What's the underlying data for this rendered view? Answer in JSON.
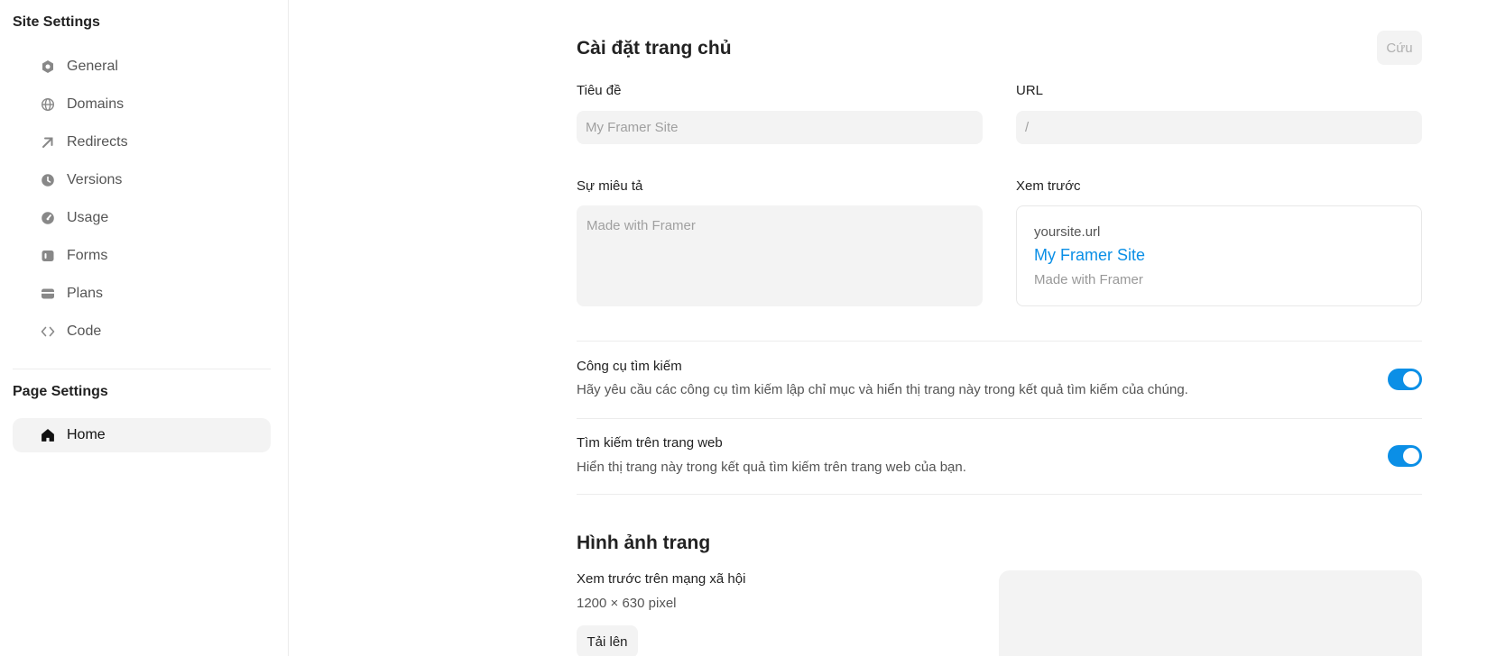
{
  "sidebar": {
    "site_settings_title": "Site Settings",
    "items": [
      {
        "label": "General",
        "icon": "hexagon-icon"
      },
      {
        "label": "Domains",
        "icon": "globe-icon"
      },
      {
        "label": "Redirects",
        "icon": "arrow-up-right-icon"
      },
      {
        "label": "Versions",
        "icon": "clock-icon"
      },
      {
        "label": "Usage",
        "icon": "gauge-icon"
      },
      {
        "label": "Forms",
        "icon": "form-icon"
      },
      {
        "label": "Plans",
        "icon": "card-icon"
      },
      {
        "label": "Code",
        "icon": "code-icon"
      }
    ],
    "page_settings_title": "Page Settings",
    "pages": [
      {
        "label": "Home",
        "icon": "home-icon",
        "active": true
      }
    ]
  },
  "main": {
    "title": "Cài đặt trang chủ",
    "save_label": "Cứu",
    "title_field": {
      "label": "Tiêu đề",
      "value": "",
      "placeholder": "My Framer Site"
    },
    "url_field": {
      "label": "URL",
      "value": "",
      "placeholder": "/"
    },
    "description_field": {
      "label": "Sự miêu tả",
      "value": "",
      "placeholder": "Made with Framer"
    },
    "preview": {
      "label": "Xem trước",
      "url": "yoursite.url",
      "title": "My Framer Site",
      "description": "Made with Framer"
    },
    "search_engines": {
      "title": "Công cụ tìm kiếm",
      "description": "Hãy yêu cầu các công cụ tìm kiếm lập chỉ mục và hiển thị trang này trong kết quả tìm kiếm của chúng.",
      "enabled": true
    },
    "site_search": {
      "title": "Tìm kiếm trên trang web",
      "description": "Hiển thị trang này trong kết quả tìm kiếm trên trang web của bạn.",
      "enabled": true
    },
    "page_images": {
      "title": "Hình ảnh trang",
      "social_preview_label": "Xem trước trên mạng xã hội",
      "size_hint": "1200 × 630 pixel",
      "upload_label": "Tải lên"
    }
  },
  "colors": {
    "accent": "#0b8fe6",
    "field_bg": "#f3f3f3",
    "divider": "#ececec"
  }
}
